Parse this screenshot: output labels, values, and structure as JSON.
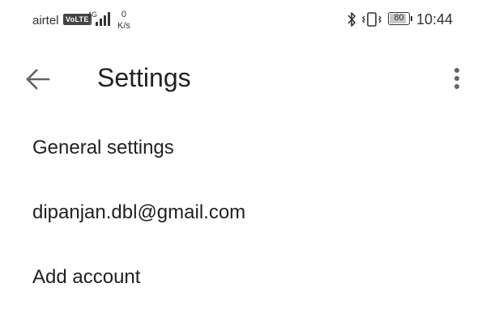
{
  "status_bar": {
    "carrier": "airtel",
    "volte_badge": "VoLTE",
    "network_type": "4G",
    "network_sub": "1",
    "speed_value": "0",
    "speed_unit": "K/s",
    "battery_level": "80",
    "time": "10:44",
    "icons": [
      "bluetooth-icon",
      "vibrate-icon",
      "battery-icon",
      "signal-icon"
    ]
  },
  "app_bar": {
    "title": "Settings",
    "back_icon": "arrow-back-icon",
    "overflow_icon": "more-vert-icon"
  },
  "settings_list": {
    "items": [
      {
        "label": "General settings"
      },
      {
        "label": "dipanjan.dbl@gmail.com"
      },
      {
        "label": "Add account"
      }
    ]
  }
}
